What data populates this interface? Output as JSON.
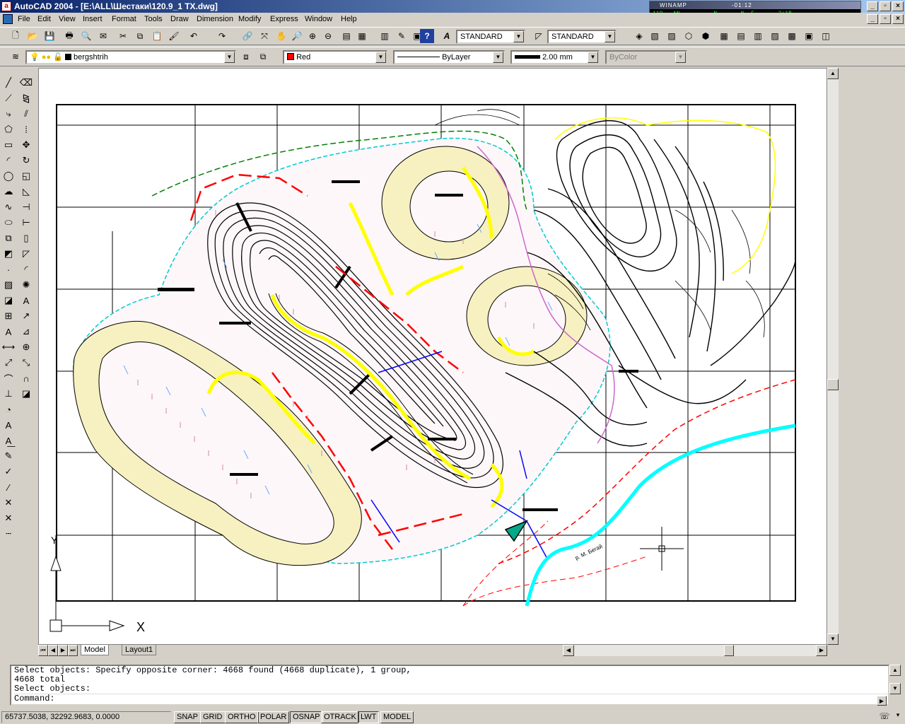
{
  "app": {
    "title": "AutoCAD 2004 - [E:\\ALL\\Шестаки\\120.9_1 TX.dwg]",
    "icon_letter": "a"
  },
  "winamp": {
    "header": "WINAMP",
    "time": "-01:12",
    "lcd": "119.  AN        - N       N  E       3:18"
  },
  "window_controls": {
    "minimize": "_",
    "restore": "▫",
    "close": "×"
  },
  "menu": [
    "File",
    "Edit",
    "View",
    "Insert",
    "Format",
    "Tools",
    "Draw",
    "Dimension",
    "Modify",
    "Express",
    "Window",
    "Help"
  ],
  "styles": {
    "text_style": "STANDARD",
    "dim_style": "STANDARD"
  },
  "properties": {
    "layer": "bergshtrih",
    "color": "Red",
    "color_hex": "#ff0000",
    "linetype": "ByLayer",
    "lineweight": "2.00 mm",
    "plotstyle": "ByColor"
  },
  "layout_tabs": [
    {
      "label": "Model",
      "active": true
    },
    {
      "label": "Layout1",
      "active": false
    }
  ],
  "command": {
    "lines": [
      "Select objects: Specify opposite corner: 4668 found (4668 duplicate), 1 group,",
      "4668 total",
      "Select objects:"
    ],
    "prompt": "Command:"
  },
  "status": {
    "coords": "65737.5038, 32292.9683, 0.0000",
    "toggles": [
      {
        "label": "SNAP",
        "on": false
      },
      {
        "label": "GRID",
        "on": false
      },
      {
        "label": "ORTHO",
        "on": false
      },
      {
        "label": "POLAR",
        "on": false
      },
      {
        "label": "OSNAP",
        "on": true
      },
      {
        "label": "OTRACK",
        "on": false
      },
      {
        "label": "LWT",
        "on": true
      },
      {
        "label": "MODEL",
        "on": false
      }
    ]
  },
  "drawing": {
    "ucs_x": "X",
    "ucs_y": "Y",
    "river_label": "р. М. Бегай",
    "colors": {
      "cyan": "#00ffff",
      "red": "#ff0000",
      "yellow": "#ffff00",
      "fill": "#f5f0c0",
      "blue": "#0000ff",
      "green": "#008000",
      "magenta": "#cc66cc"
    }
  }
}
